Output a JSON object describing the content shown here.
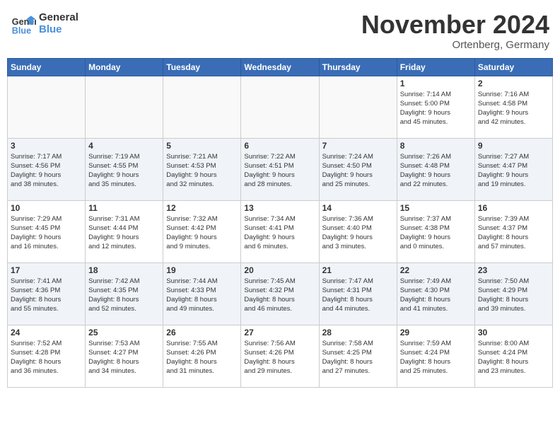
{
  "logo": {
    "line1": "General",
    "line2": "Blue"
  },
  "title": "November 2024",
  "location": "Ortenberg, Germany",
  "days_of_week": [
    "Sunday",
    "Monday",
    "Tuesday",
    "Wednesday",
    "Thursday",
    "Friday",
    "Saturday"
  ],
  "weeks": [
    [
      {
        "day": "",
        "info": ""
      },
      {
        "day": "",
        "info": ""
      },
      {
        "day": "",
        "info": ""
      },
      {
        "day": "",
        "info": ""
      },
      {
        "day": "",
        "info": ""
      },
      {
        "day": "1",
        "info": "Sunrise: 7:14 AM\nSunset: 5:00 PM\nDaylight: 9 hours\nand 45 minutes."
      },
      {
        "day": "2",
        "info": "Sunrise: 7:16 AM\nSunset: 4:58 PM\nDaylight: 9 hours\nand 42 minutes."
      }
    ],
    [
      {
        "day": "3",
        "info": "Sunrise: 7:17 AM\nSunset: 4:56 PM\nDaylight: 9 hours\nand 38 minutes."
      },
      {
        "day": "4",
        "info": "Sunrise: 7:19 AM\nSunset: 4:55 PM\nDaylight: 9 hours\nand 35 minutes."
      },
      {
        "day": "5",
        "info": "Sunrise: 7:21 AM\nSunset: 4:53 PM\nDaylight: 9 hours\nand 32 minutes."
      },
      {
        "day": "6",
        "info": "Sunrise: 7:22 AM\nSunset: 4:51 PM\nDaylight: 9 hours\nand 28 minutes."
      },
      {
        "day": "7",
        "info": "Sunrise: 7:24 AM\nSunset: 4:50 PM\nDaylight: 9 hours\nand 25 minutes."
      },
      {
        "day": "8",
        "info": "Sunrise: 7:26 AM\nSunset: 4:48 PM\nDaylight: 9 hours\nand 22 minutes."
      },
      {
        "day": "9",
        "info": "Sunrise: 7:27 AM\nSunset: 4:47 PM\nDaylight: 9 hours\nand 19 minutes."
      }
    ],
    [
      {
        "day": "10",
        "info": "Sunrise: 7:29 AM\nSunset: 4:45 PM\nDaylight: 9 hours\nand 16 minutes."
      },
      {
        "day": "11",
        "info": "Sunrise: 7:31 AM\nSunset: 4:44 PM\nDaylight: 9 hours\nand 12 minutes."
      },
      {
        "day": "12",
        "info": "Sunrise: 7:32 AM\nSunset: 4:42 PM\nDaylight: 9 hours\nand 9 minutes."
      },
      {
        "day": "13",
        "info": "Sunrise: 7:34 AM\nSunset: 4:41 PM\nDaylight: 9 hours\nand 6 minutes."
      },
      {
        "day": "14",
        "info": "Sunrise: 7:36 AM\nSunset: 4:40 PM\nDaylight: 9 hours\nand 3 minutes."
      },
      {
        "day": "15",
        "info": "Sunrise: 7:37 AM\nSunset: 4:38 PM\nDaylight: 9 hours\nand 0 minutes."
      },
      {
        "day": "16",
        "info": "Sunrise: 7:39 AM\nSunset: 4:37 PM\nDaylight: 8 hours\nand 57 minutes."
      }
    ],
    [
      {
        "day": "17",
        "info": "Sunrise: 7:41 AM\nSunset: 4:36 PM\nDaylight: 8 hours\nand 55 minutes."
      },
      {
        "day": "18",
        "info": "Sunrise: 7:42 AM\nSunset: 4:35 PM\nDaylight: 8 hours\nand 52 minutes."
      },
      {
        "day": "19",
        "info": "Sunrise: 7:44 AM\nSunset: 4:33 PM\nDaylight: 8 hours\nand 49 minutes."
      },
      {
        "day": "20",
        "info": "Sunrise: 7:45 AM\nSunset: 4:32 PM\nDaylight: 8 hours\nand 46 minutes."
      },
      {
        "day": "21",
        "info": "Sunrise: 7:47 AM\nSunset: 4:31 PM\nDaylight: 8 hours\nand 44 minutes."
      },
      {
        "day": "22",
        "info": "Sunrise: 7:49 AM\nSunset: 4:30 PM\nDaylight: 8 hours\nand 41 minutes."
      },
      {
        "day": "23",
        "info": "Sunrise: 7:50 AM\nSunset: 4:29 PM\nDaylight: 8 hours\nand 39 minutes."
      }
    ],
    [
      {
        "day": "24",
        "info": "Sunrise: 7:52 AM\nSunset: 4:28 PM\nDaylight: 8 hours\nand 36 minutes."
      },
      {
        "day": "25",
        "info": "Sunrise: 7:53 AM\nSunset: 4:27 PM\nDaylight: 8 hours\nand 34 minutes."
      },
      {
        "day": "26",
        "info": "Sunrise: 7:55 AM\nSunset: 4:26 PM\nDaylight: 8 hours\nand 31 minutes."
      },
      {
        "day": "27",
        "info": "Sunrise: 7:56 AM\nSunset: 4:26 PM\nDaylight: 8 hours\nand 29 minutes."
      },
      {
        "day": "28",
        "info": "Sunrise: 7:58 AM\nSunset: 4:25 PM\nDaylight: 8 hours\nand 27 minutes."
      },
      {
        "day": "29",
        "info": "Sunrise: 7:59 AM\nSunset: 4:24 PM\nDaylight: 8 hours\nand 25 minutes."
      },
      {
        "day": "30",
        "info": "Sunrise: 8:00 AM\nSunset: 4:24 PM\nDaylight: 8 hours\nand 23 minutes."
      }
    ]
  ]
}
